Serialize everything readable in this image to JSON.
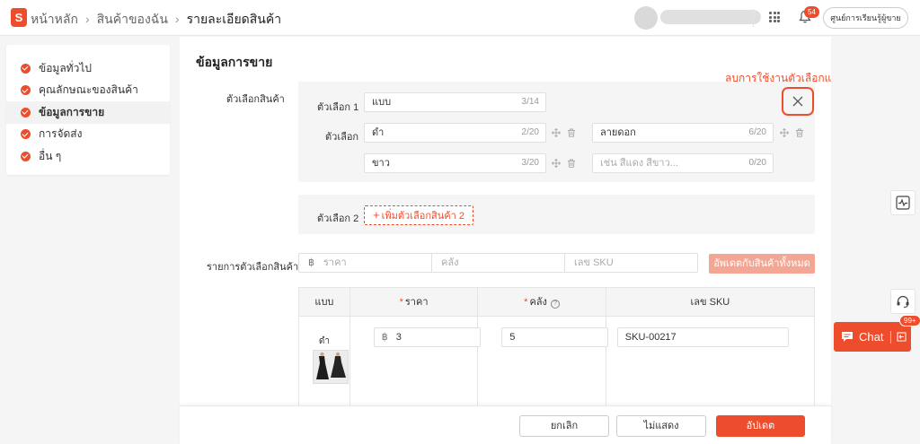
{
  "header": {
    "logo_letter": "S",
    "breadcrumbs": [
      "หน้าหลัก",
      "สินค้าของฉัน",
      "รายละเอียดสินค้า"
    ],
    "notification_count": "54",
    "learning_center_label": "ศูนย์การเรียนรู้ผู้ขาย"
  },
  "sidebar": {
    "items": [
      {
        "label": "ข้อมูลทั่วไป"
      },
      {
        "label": "คุณลักษณะของสินค้า"
      },
      {
        "label": "ข้อมูลการขาย"
      },
      {
        "label": "การจัดส่ง"
      },
      {
        "label": "อื่น ๆ"
      }
    ]
  },
  "main": {
    "section_title": "ข้อมูลการขาย",
    "annotation": "ลบการใช้งานตัวเลือกแบบสินค้า",
    "variation_label": "ตัวเลือกสินค้า",
    "variation1": {
      "label": "ตัวเลือก 1",
      "name_value": "แบบ",
      "name_count": "3/14",
      "options_label": "ตัวเลือก",
      "options": [
        {
          "value": "ดำ",
          "count": "2/20"
        },
        {
          "value": "ลายดอก",
          "count": "6/20"
        },
        {
          "value": "ขาว",
          "count": "3/20"
        },
        {
          "placeholder": "เช่น สีแดง สีขาว...",
          "count": "0/20"
        }
      ]
    },
    "variation2": {
      "label": "ตัวเลือก 2",
      "add_label": "เพิ่มตัวเลือกสินค้า 2"
    },
    "variation_list": {
      "label": "รายการตัวเลือกสินค้า",
      "currency": "฿",
      "price_placeholder": "ราคา",
      "stock_placeholder": "คลัง",
      "sku_placeholder": "เลข SKU",
      "apply_all_label": "อัพเดตกับสินค้าทั้งหมด"
    },
    "table": {
      "headers": {
        "variant": "แบบ",
        "price": "ราคา",
        "stock": "คลัง",
        "sku": "เลข SKU",
        "required_mark": "*",
        "help_mark": "?"
      },
      "rows": [
        {
          "variant": "ดำ",
          "currency": "฿",
          "price": "3",
          "stock": "5",
          "sku": "SKU-00217"
        }
      ]
    }
  },
  "footer": {
    "cancel_label": "ยกเลิก",
    "hide_label": "ไม่แสดง",
    "update_label": "อัปเดต"
  },
  "float": {
    "chat_label": "Chat",
    "chat_badge": "99+"
  },
  "colors": {
    "accent": "#ee4d2d",
    "accent_light": "#f3a693"
  }
}
